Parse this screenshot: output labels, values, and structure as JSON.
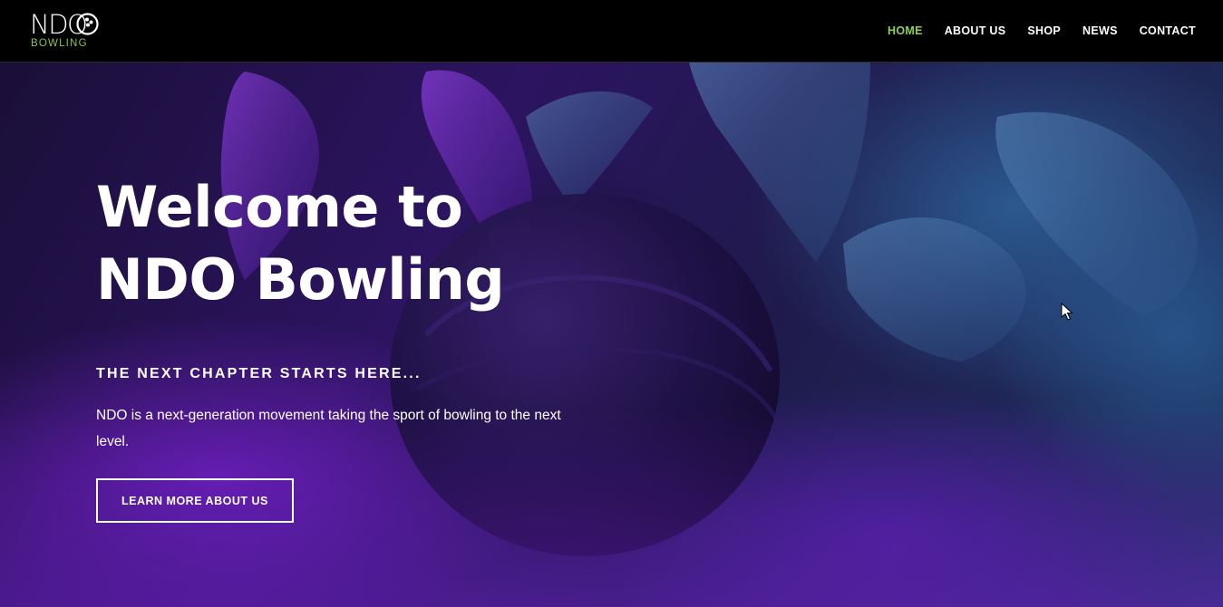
{
  "header": {
    "logo": {
      "top_text": "NDO",
      "bottom_text": "BOWLING",
      "accent_color": "#8cc63f"
    },
    "nav": [
      {
        "label": "HOME",
        "active": true
      },
      {
        "label": "ABOUT US",
        "active": false
      },
      {
        "label": "SHOP",
        "active": false
      },
      {
        "label": "NEWS",
        "active": false
      },
      {
        "label": "CONTACT",
        "active": false
      }
    ],
    "active_color": "#8ed14f"
  },
  "hero": {
    "title": "Welcome to\nNDO Bowling",
    "subtitle": "THE NEXT CHAPTER STARTS HERE...",
    "description": "NDO is a next-generation movement taking the sport of bowling to the next level.",
    "button_label": "LEARN MORE ABOUT US",
    "background_image": "bowling-ball-striking-pins"
  }
}
